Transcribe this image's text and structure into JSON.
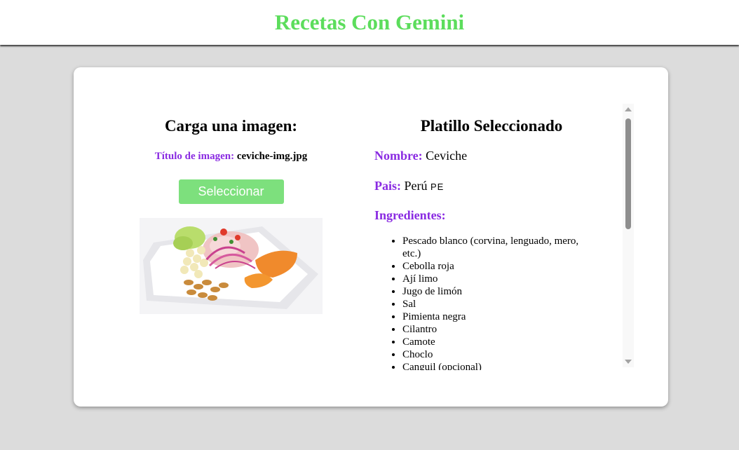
{
  "header": {
    "title": "Recetas Con Gemini"
  },
  "upload": {
    "heading": "Carga una imagen:",
    "file_label": "Título de imagen:",
    "file_name": "ceviche-img.jpg",
    "button_label": "Seleccionar"
  },
  "dish": {
    "heading": "Platillo Seleccionado",
    "name_label": "Nombre:",
    "name": "Ceviche",
    "country_label": "Pais:",
    "country": "Perú",
    "country_flag": "PE",
    "ingredients_label": "Ingredientes:",
    "ingredients": [
      "Pescado blanco (corvina, lenguado, mero, etc.)",
      "Cebolla roja",
      "Ají limo",
      "Jugo de limón",
      "Sal",
      "Pimienta negra",
      "Cilantro",
      "Camote",
      "Choclo",
      "Canguil (opcional)"
    ]
  },
  "colors": {
    "title_green": "#5cdd5c",
    "label_purple": "#8a2be2",
    "button_green": "#7de07d",
    "background": "#dcdcdc"
  }
}
